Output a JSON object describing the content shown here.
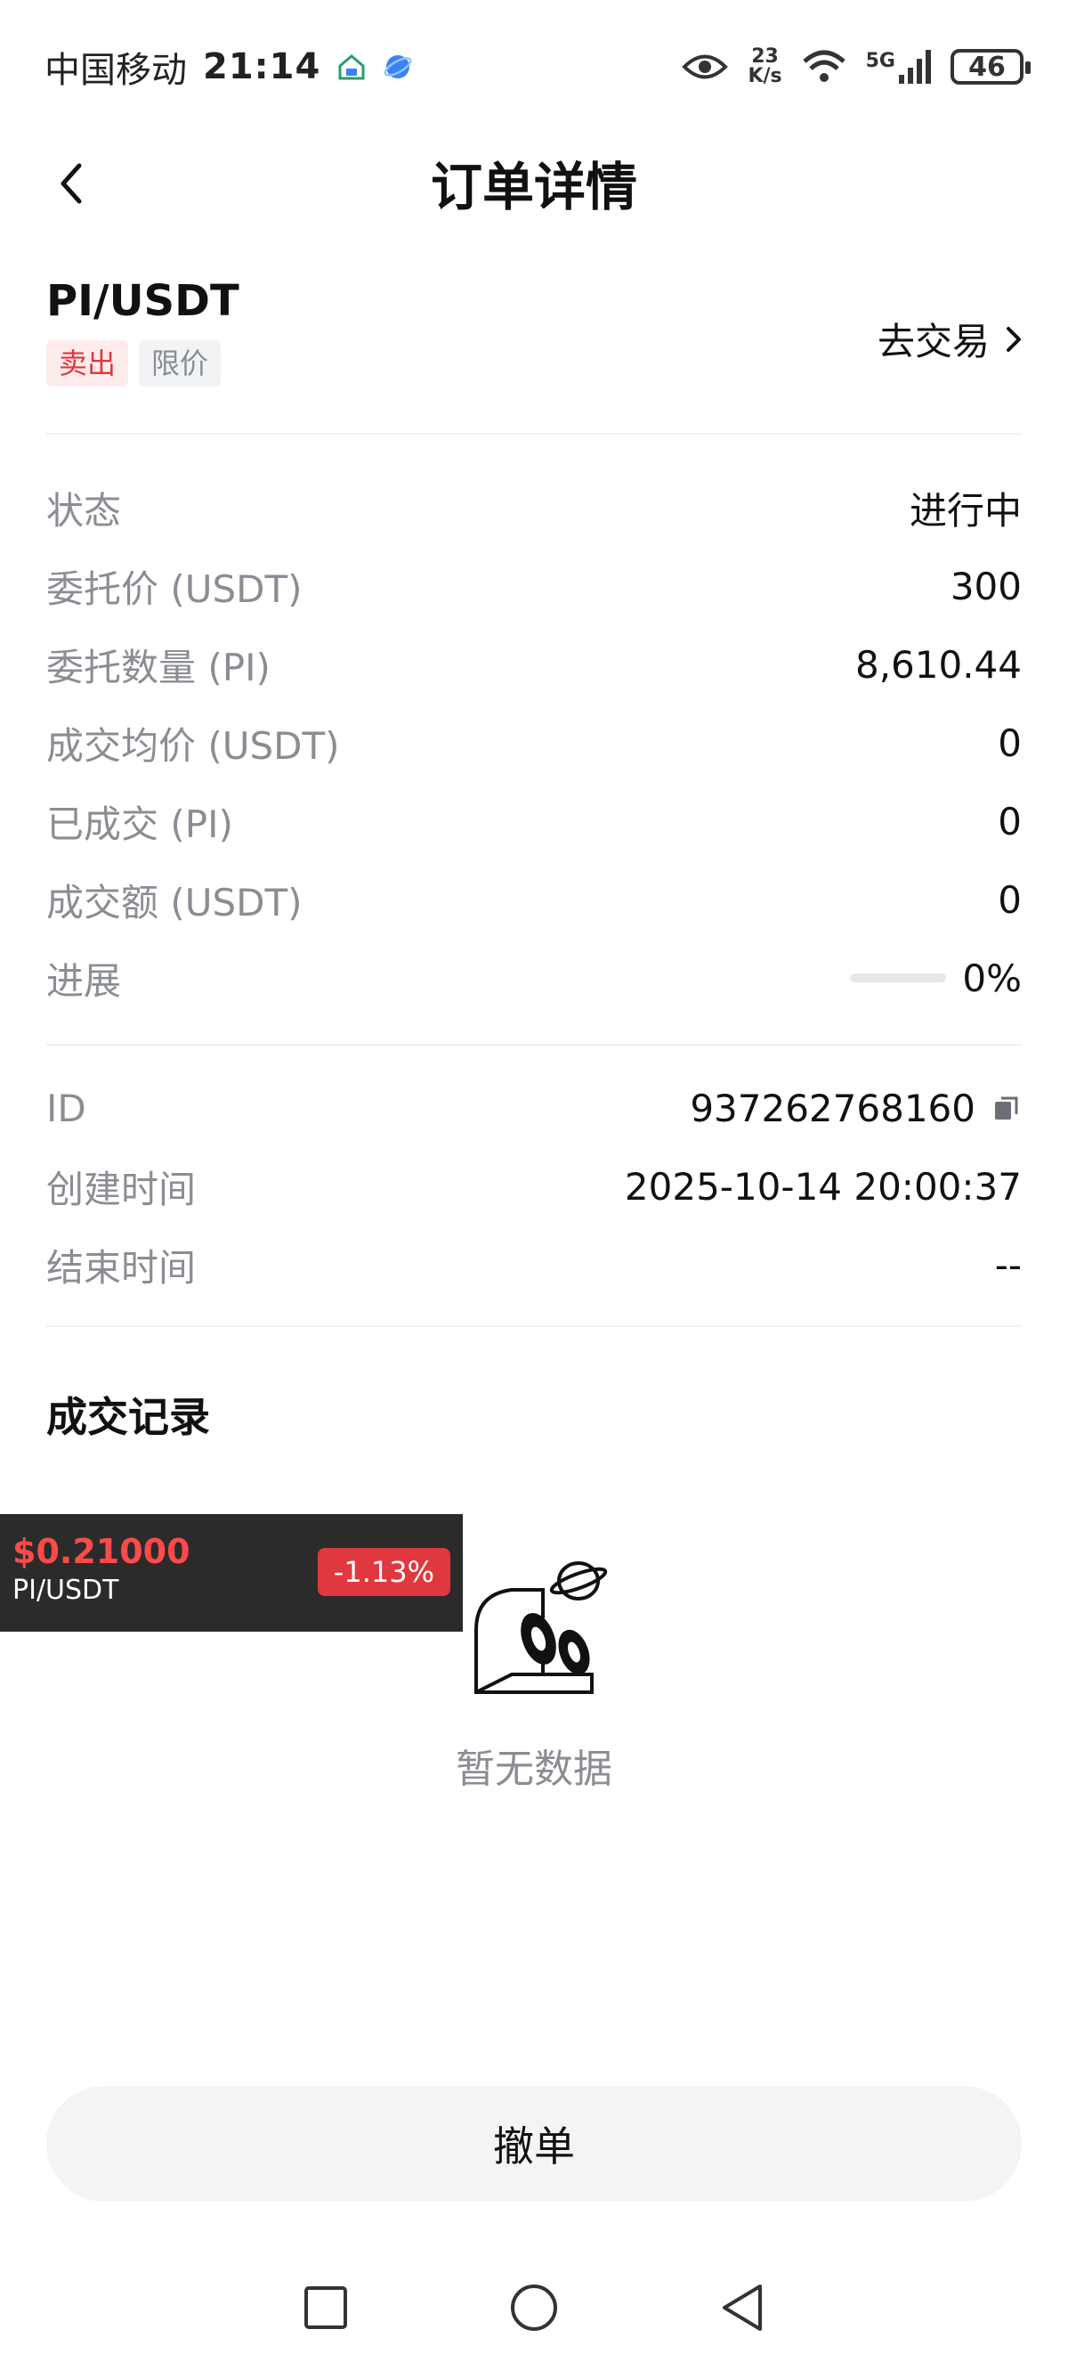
{
  "status_bar": {
    "carrier": "中国移动",
    "time": "21:14",
    "net_speed_value": "23",
    "net_speed_unit": "K/s",
    "network_type": "5G",
    "battery": "46"
  },
  "header": {
    "title": "订单详情"
  },
  "order": {
    "pair": "PI/USDT",
    "side_tag": "卖出",
    "type_tag": "限价",
    "go_trade_label": "去交易"
  },
  "details": [
    {
      "label": "状态",
      "value": "进行中"
    },
    {
      "label": "委托价 (USDT)",
      "value": "300"
    },
    {
      "label": "委托数量 (PI)",
      "value": "8,610.44"
    },
    {
      "label": "成交均价 (USDT)",
      "value": "0"
    },
    {
      "label": "已成交 (PI)",
      "value": "0"
    },
    {
      "label": "成交额 (USDT)",
      "value": "0"
    }
  ],
  "progress": {
    "label": "进展",
    "value_text": "0%",
    "fraction": 0
  },
  "meta": [
    {
      "label": "ID",
      "value": "937262768160"
    },
    {
      "label": "创建时间",
      "value": "2025-10-14 20:00:37"
    },
    {
      "label": "结束时间",
      "value": "--"
    }
  ],
  "records": {
    "title": "成交记录",
    "empty_text": "暂无数据"
  },
  "ticker": {
    "price": "$0.21000",
    "pair": "PI/USDT",
    "change": "-1.13%"
  },
  "actions": {
    "cancel_label": "撤单"
  },
  "colors": {
    "sell_red": "#e0383e",
    "muted_gray": "#8a8d93",
    "button_bg": "#f3f4f6"
  }
}
